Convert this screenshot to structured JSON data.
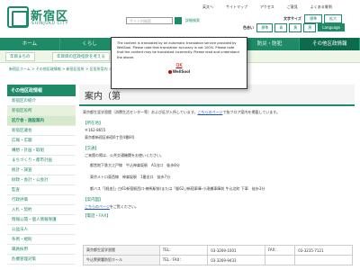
{
  "header": {
    "logo_title": "新宿区",
    "logo_sub": "SHINJUKU CITY",
    "search_placeholder": "サイト内検索",
    "detail_search": "詳細検索",
    "top_links": [
      "英文へ",
      "サイトマップ",
      "アクセス",
      "ご意見",
      "よくある質問"
    ],
    "text_size_label": "文字サイズ",
    "text_size_options": [
      "標準",
      "拡大"
    ],
    "lang_label": "色合い",
    "lang_options": [
      "標準",
      "青",
      "黄",
      "黒",
      "Language"
    ]
  },
  "gnav": [
    "ホーム",
    "くらし",
    "",
    "",
    "防災・防犯",
    "その他区政情報"
  ],
  "subnav": [
    "年目まちの",
    "年目目の区政指針を考える"
  ],
  "breadcrumb": "新宿区ホーム > その他区政情報 > 新宿区役所 > 区役所案内 > 区庁舎・施設案内 > 案内（第一分庁舎・第二分庁舎）",
  "sidebar": {
    "heading": "その他区政情報",
    "items": [
      {
        "label": "新宿区の紹介",
        "type": "normal"
      },
      {
        "label": "新宿区役所",
        "type": "sub"
      },
      {
        "label": "区庁舎・施設案内",
        "type": "active"
      },
      {
        "label": "新宿区議会",
        "type": "normal"
      },
      {
        "label": "広報・広聴",
        "type": "normal"
      },
      {
        "label": "構想・計画・取組",
        "type": "normal"
      },
      {
        "label": "まちづくり・都市計画",
        "type": "normal"
      },
      {
        "label": "統計・調査",
        "type": "normal"
      },
      {
        "label": "財政・会計・公会計",
        "type": "normal"
      },
      {
        "label": "監査",
        "type": "normal"
      },
      {
        "label": "行政評価",
        "type": "normal"
      },
      {
        "label": "入札・契約",
        "type": "normal"
      },
      {
        "label": "情報公開・個人情報保護",
        "type": "normal"
      },
      {
        "label": "公益法人",
        "type": "normal"
      },
      {
        "label": "条例・規則",
        "type": "normal"
      },
      {
        "label": "職員採用",
        "type": "normal"
      },
      {
        "label": "危機管理対策",
        "type": "normal"
      }
    ]
  },
  "main": {
    "title": "案内（第",
    "intro": "東京都生涯学習館（消費生活センター等）および区が入所しています。",
    "intro_link": "こちらのページ",
    "intro_suffix": "で各フロア案内を掲載しています。",
    "address_title": "【所在地】",
    "address_lines": [
      "〒162-8655",
      "東京都新宿区新宿6丁目4番8号"
    ],
    "access_title": "【交通】",
    "access_lead": "ご来館の際は、公共交通機関をお使いください。",
    "access_lines": [
      "都営地下鉄大江戸線　牛込神楽坂駅　A1出口　徒歩8分",
      "東京メトロ東西線　神楽坂駅　1番出口　徒歩7分",
      "都バス「[経由]」白61新宿駅西口-練馬駅前(または「飯62」)新宿車庫-小滝橋車庫前 牛込北町 下車　徒歩3分"
    ],
    "map_title": "【案内図】",
    "map_link": "こちらのページ",
    "map_suffix": "をご覧ください。"
  },
  "fax_table": {
    "heading": "【電話・FAX】",
    "rows": [
      {
        "name": "東京都生涯学習館",
        "tel_label": "TEL：",
        "tel": "03-3269-1001",
        "fax_label": "FAX：",
        "fax": "03-3235-7121"
      },
      {
        "name": "牛込警察署防犯ホール",
        "tel_label": "TEL／FAX：",
        "tel": "03-3269-9433",
        "fax_label": "",
        "fax": ""
      }
    ]
  },
  "modal": {
    "text": "The content is translated by an automatic translation service provided by WellSool. Please note that translation accuracy is not 100%. Please note that the content may be translated incorrectly. Please read and understand the above.",
    "ok": "OK",
    "logo": "WellSool"
  }
}
